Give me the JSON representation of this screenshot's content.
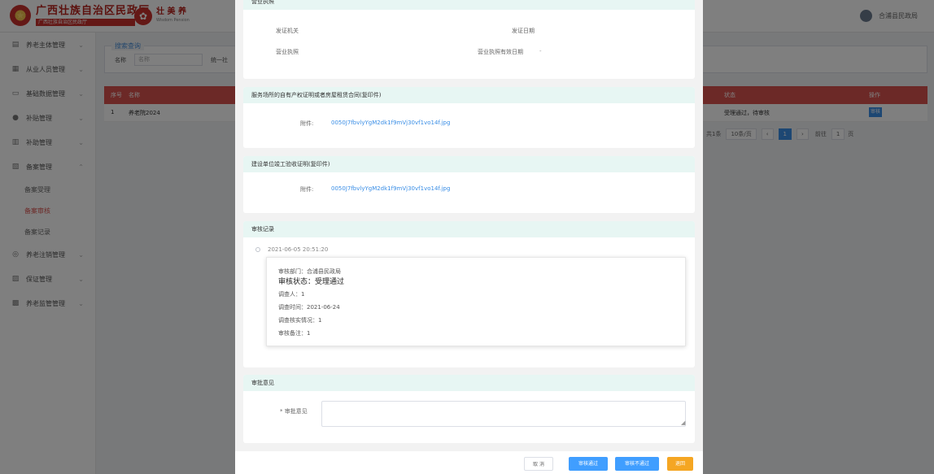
{
  "header": {
    "brand_title": "广西壮族自治区民政厅",
    "brand_subtitle": "广西壮族自治区民政厅",
    "partner_name": "壮 美 养",
    "partner_sub": "Wisdom Pension",
    "user_name": "合浦县民政局"
  },
  "sidebar": {
    "items": [
      {
        "icon": "▤",
        "label": "养老主体管理",
        "name": "sidebar-item-elderly-subject"
      },
      {
        "icon": "▦",
        "label": "从业人员管理",
        "name": "sidebar-item-staff"
      },
      {
        "icon": "▭",
        "label": "基础数据管理",
        "name": "sidebar-item-basic-data"
      },
      {
        "icon": "●",
        "label": "补贴管理",
        "name": "sidebar-item-subsidy"
      },
      {
        "icon": "▥",
        "label": "补助管理",
        "name": "sidebar-item-aid"
      },
      {
        "icon": "▧",
        "label": "备案管理",
        "name": "sidebar-item-filing"
      }
    ],
    "sub_items": [
      {
        "label": "备案受理",
        "active": false
      },
      {
        "label": "备案审核",
        "active": true
      },
      {
        "label": "备案记录",
        "active": false
      }
    ],
    "items_after": [
      {
        "icon": "◎",
        "label": "养老注销管理",
        "name": "sidebar-item-cancellation"
      },
      {
        "icon": "▨",
        "label": "保证管理",
        "name": "sidebar-item-guarantee"
      },
      {
        "icon": "▩",
        "label": "养老监管管理",
        "name": "sidebar-item-supervision"
      }
    ]
  },
  "search": {
    "legend": "搜索查询",
    "name_label": "名称",
    "name_placeholder": "名称",
    "code_label": "统一社"
  },
  "table": {
    "headers": [
      "序号",
      "名称",
      "状态",
      "操作"
    ],
    "rows": [
      {
        "index": "1",
        "name": "养老院2024",
        "status": "受理通过，待审核",
        "action": "审核"
      }
    ],
    "pager": {
      "total": "共1条",
      "page_size": "10条/页",
      "current": "1",
      "goto_label": "前往",
      "goto_value": "1",
      "goto_unit": "页"
    }
  },
  "dialog": {
    "card1": {
      "heading": "营业执照",
      "issuer_label": "发证机关",
      "issue_date_label": "发证日期",
      "license_label": "营业执照",
      "license_validity_label": "营业执照有效日期",
      "license_validity_value": "-"
    },
    "card2": {
      "heading": "服务场所的自有产权证明或者房屋租赁合同(复印件)",
      "attachment_label": "附件:",
      "attachment_file": "0050J7fbvlyYgM2dk1f9mVj30vf1vo14f.jpg"
    },
    "card3": {
      "heading": "建设单位竣工验收证明(复印件)",
      "attachment_label": "附件:",
      "attachment_file": "0050J7fbvlyYgM2dk1f9mVj30vf1vo14f.jpg"
    },
    "record": {
      "heading": "审核记录",
      "time": "2021-06-05 20:51:20",
      "dept": "审核部门：合浦县民政局",
      "status": "审核状态：受理通过",
      "surveyor": "调查人：1",
      "survey_time": "调查时间：2021-06-24",
      "survey_status": "调查核实情况：1",
      "remark": "审核备注：1"
    },
    "remark_card": {
      "heading": "审批意见",
      "field_label": "* 审批意见",
      "field_value": ""
    },
    "buttons": {
      "cancel": "取 消",
      "pass": "审核通过",
      "reject": "审核不通过",
      "return": "退回"
    }
  },
  "colors": {
    "primary": "#409eff",
    "brand_red": "#d9534f",
    "warning": "#f5a623",
    "section_head": "#e7f6f3"
  }
}
